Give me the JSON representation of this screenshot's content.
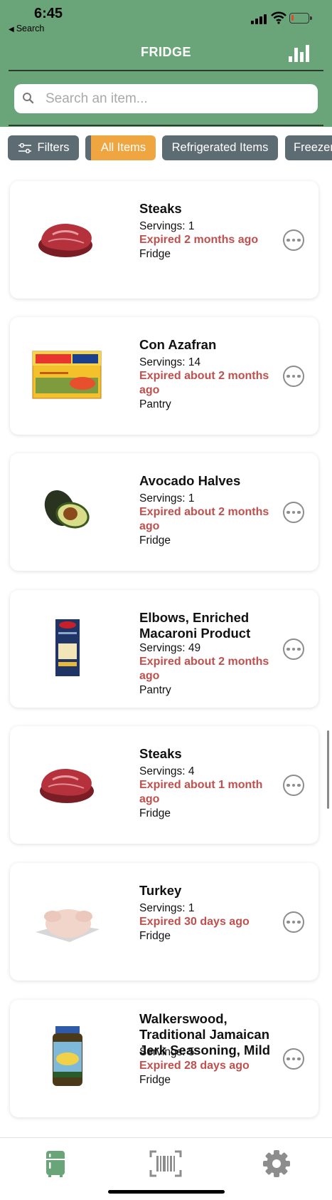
{
  "status": {
    "time": "6:45",
    "back_label": "Search",
    "battery_color": "#e04b2f"
  },
  "header": {
    "title": "FRIDGE",
    "stats_icon": "bar-chart-icon",
    "bg_color": "#6aa57a"
  },
  "search": {
    "placeholder": "Search an item...",
    "value": ""
  },
  "filters": {
    "filters_label": "Filters",
    "chips": [
      {
        "label": "All Items",
        "active": true
      },
      {
        "label": "Refrigerated Items",
        "active": false
      },
      {
        "label": "Freezer",
        "active": false
      }
    ],
    "active_color": "#f0a640",
    "inactive_color": "#5d6b73"
  },
  "items": [
    {
      "name": "Steaks",
      "servings": "Servings: 1",
      "expiry": "Expired 2 months ago",
      "location": "Fridge",
      "image": "steak-image"
    },
    {
      "name": "Con Azafran",
      "servings": "Servings: 14",
      "expiry": "Expired about 2 months ago",
      "location": "Pantry",
      "image": "sazon-goya-box-image"
    },
    {
      "name": "Avocado Halves",
      "servings": "Servings: 1",
      "expiry": "Expired about 2 months ago",
      "location": "Fridge",
      "image": "avocado-image"
    },
    {
      "name": "Elbows, Enriched Macaroni Product",
      "servings": "Servings: 49",
      "expiry": "Expired about 2 months ago",
      "location": "Pantry",
      "image": "barilla-elbows-box-image"
    },
    {
      "name": "Steaks",
      "servings": "Servings: 4",
      "expiry": "Expired about 1 month ago",
      "location": "Fridge",
      "image": "steak-image"
    },
    {
      "name": "Turkey",
      "servings": "Servings: 1",
      "expiry": "Expired 30 days ago",
      "location": "Fridge",
      "image": "turkey-image"
    },
    {
      "name": "Walkerswood, Traditional Jamaican Jerk Seasoning, Mild",
      "servings": "Servings: 5",
      "expiry": "Expired 28 days ago",
      "location": "Fridge",
      "image": "jerk-seasoning-jar-image"
    }
  ],
  "expired_color": "#c0504d",
  "tabbar": {
    "tabs": [
      "fridge-icon",
      "barcode-scan-icon",
      "settings-gear-icon"
    ],
    "active_color": "#6aa57a",
    "inactive_color": "#8d8d8d"
  }
}
